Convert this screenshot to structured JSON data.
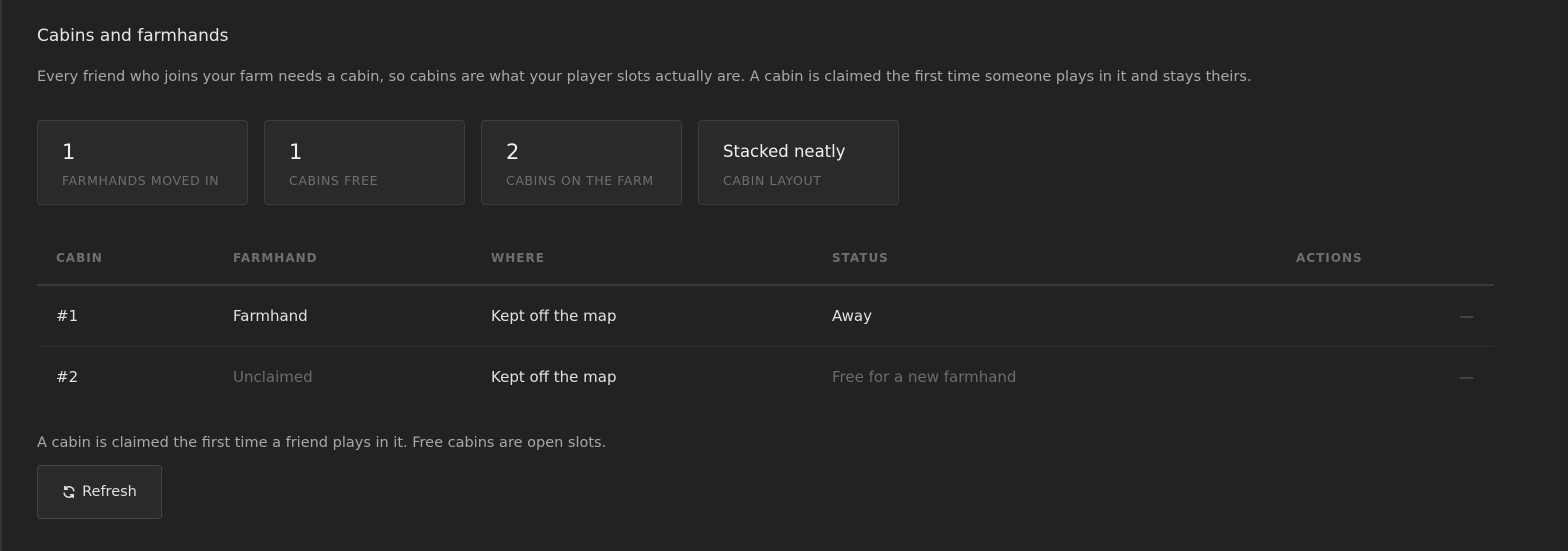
{
  "section": {
    "title": "Cabins and farmhands",
    "description": "Every friend who joins your farm needs a cabin, so cabins are what your player slots actually are. A cabin is claimed the first time someone plays in it and stays theirs."
  },
  "stats": [
    {
      "value": "1",
      "label": "Farmhands moved in"
    },
    {
      "value": "1",
      "label": "Cabins free"
    },
    {
      "value": "2",
      "label": "Cabins on the farm"
    },
    {
      "value": "Stacked neatly",
      "label": "Cabin layout"
    }
  ],
  "table": {
    "headers": [
      "Cabin",
      "Farmhand",
      "Where",
      "Status",
      "Actions"
    ],
    "rows": [
      {
        "cabin": "#1",
        "farmhand": "Farmhand",
        "where": "Kept off the map",
        "status": "Away",
        "actions": "—"
      },
      {
        "cabin": "#2",
        "farmhand": "Unclaimed",
        "where": "Kept off the map",
        "status": "Free for a new farmhand",
        "actions": "—"
      }
    ]
  },
  "footer": {
    "note": "A cabin is claimed the first time a friend plays in it. Free cabins are open slots.",
    "refresh_label": "Refresh",
    "refresh_icon": "refresh-icon"
  }
}
